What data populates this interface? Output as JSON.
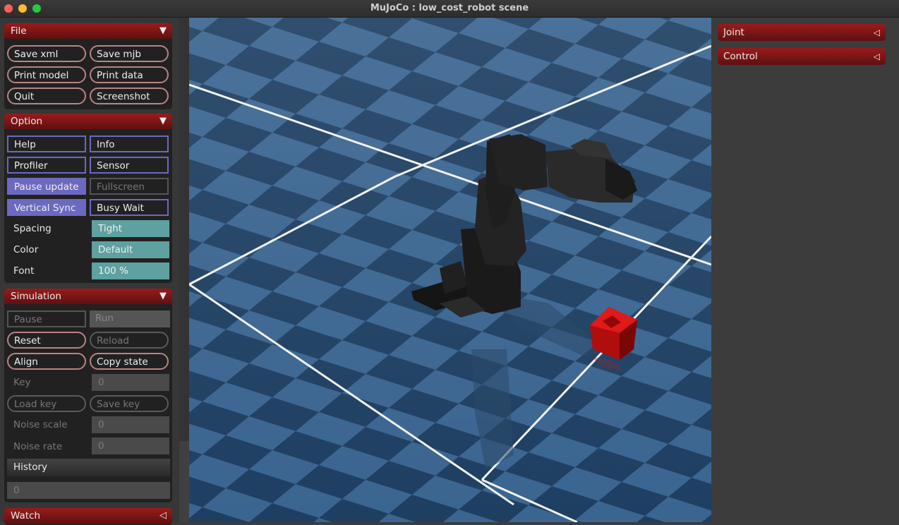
{
  "window": {
    "title": "MuJoCo : low_cost_robot scene"
  },
  "file": {
    "header": "File",
    "buttons": [
      "Save xml",
      "Save mjb",
      "Print model",
      "Print data",
      "Quit",
      "Screenshot"
    ]
  },
  "option": {
    "header": "Option",
    "toggles": [
      "Help",
      "Info",
      "Profiler",
      "Sensor",
      "Pause update",
      "Fullscreen",
      "Vertical Sync",
      "Busy Wait"
    ],
    "spacing_label": "Spacing",
    "spacing_value": "Tight",
    "color_label": "Color",
    "color_value": "Default",
    "font_label": "Font",
    "font_value": "100 %"
  },
  "simulation": {
    "header": "Simulation",
    "pause": "Pause",
    "run": "Run",
    "reset": "Reset",
    "reload": "Reload",
    "align": "Align",
    "copy_state": "Copy state",
    "key_label": "Key",
    "key_value": "0",
    "load_key": "Load key",
    "save_key": "Save key",
    "noise_scale_label": "Noise scale",
    "noise_scale_value": "0",
    "noise_rate_label": "Noise rate",
    "noise_rate_value": "0",
    "history_label": "History",
    "history_value": "0"
  },
  "watch": {
    "header": "Watch"
  },
  "right": {
    "joint": "Joint",
    "control": "Control"
  },
  "icons": {
    "collapse": "▼",
    "expand": "◁"
  },
  "colors": {
    "header_red": "#8a1818",
    "accent_purple": "#6b69c0",
    "teal": "#5fa0a0",
    "cube_red": "#c41010"
  }
}
